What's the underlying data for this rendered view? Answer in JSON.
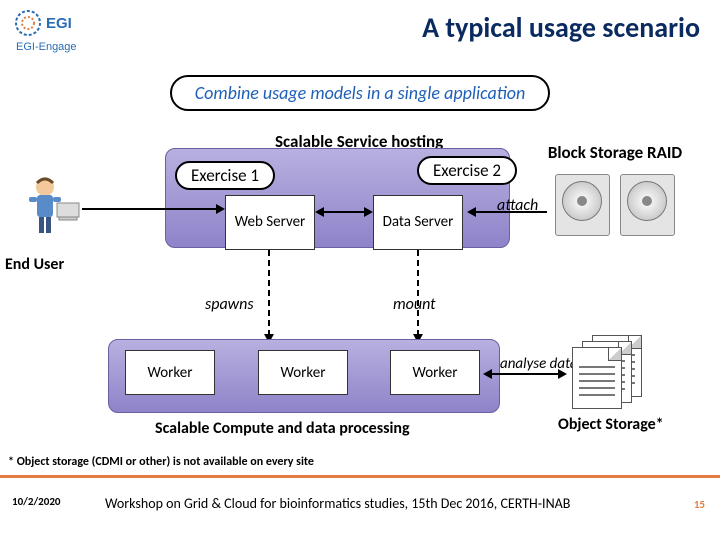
{
  "title": "A typical usage scenario",
  "subtitle": "Combine usage models in a single application",
  "labels": {
    "scalable_service": "Scalable Service hosting",
    "block_storage": "Block Storage RAID",
    "exercise1": "Exercise 1",
    "exercise2": "Exercise 2",
    "web_server": "Web Server",
    "data_server": "Data Server",
    "end_user": "End User",
    "spawns": "spawns",
    "mount": "mount",
    "attach": "attach",
    "worker": "Worker",
    "scalable_compute": "Scalable Compute and data processing",
    "analyse": "analyse data",
    "object_storage": "Object Storage*",
    "footnote": "* Object storage (CDMI or other) is not available on every site"
  },
  "footer": {
    "date": "10/2/2020",
    "text": "Workshop on Grid & Cloud for bioinformatics studies, 15th Dec 2016, CERTH-INAB",
    "page": "15"
  },
  "logo": {
    "line1": "EGI",
    "line2": "EGI-Engage"
  }
}
